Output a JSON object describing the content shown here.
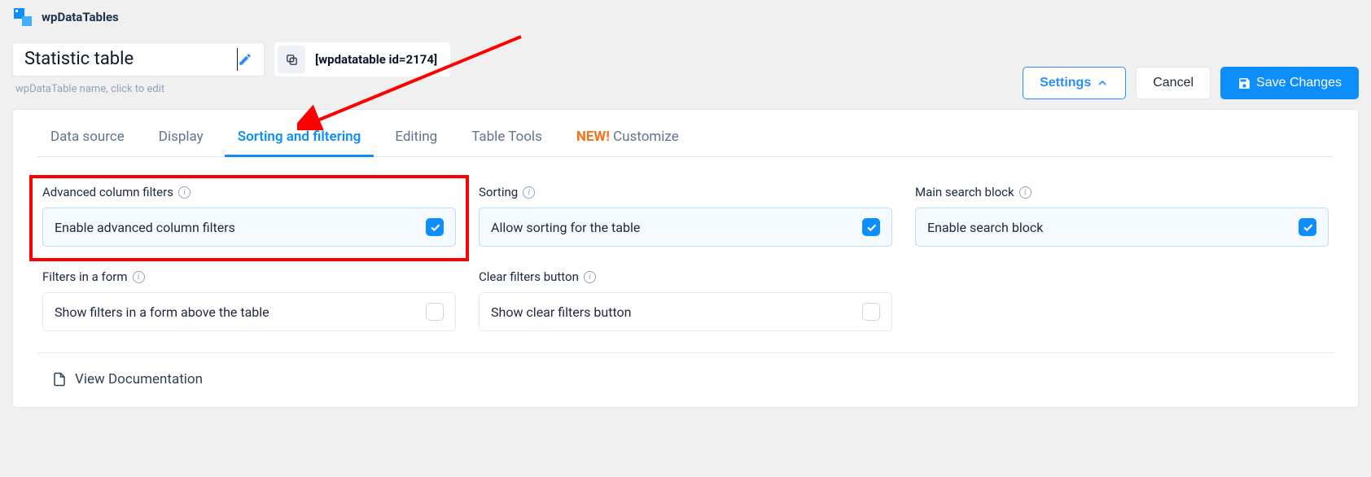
{
  "brand": {
    "name": "wpDataTables"
  },
  "title": {
    "value": "Statistic table",
    "hint": "wpDataTable name, click to edit"
  },
  "shortcode": {
    "text": "[wpdatatable id=2174]"
  },
  "actions": {
    "settings": "Settings",
    "cancel": "Cancel",
    "save": "Save Changes"
  },
  "tabs": {
    "data_source": "Data source",
    "display": "Display",
    "sorting": "Sorting and filtering",
    "editing": "Editing",
    "tools": "Table Tools",
    "new_prefix": "NEW!",
    "customize": "Customize"
  },
  "fields": {
    "adv_filters": {
      "label": "Advanced column filters",
      "option": "Enable advanced column filters",
      "checked": true
    },
    "sorting": {
      "label": "Sorting",
      "option": "Allow sorting for the table",
      "checked": true
    },
    "search": {
      "label": "Main search block",
      "option": "Enable search block",
      "checked": true
    },
    "filters_form": {
      "label": "Filters in a form",
      "option": "Show filters in a form above the table",
      "checked": false
    },
    "clear": {
      "label": "Clear filters button",
      "option": "Show clear filters button",
      "checked": false
    }
  },
  "doc_link": "View Documentation"
}
